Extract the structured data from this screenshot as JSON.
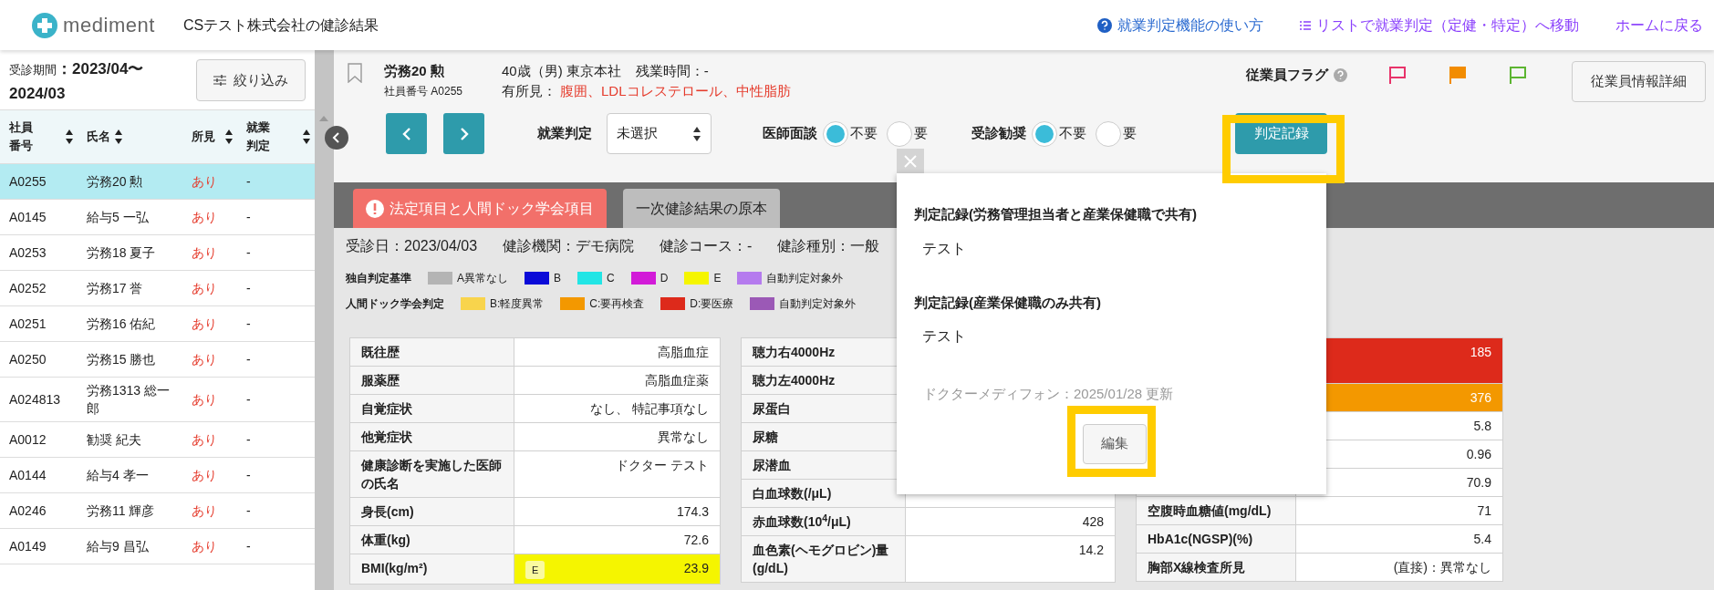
{
  "header": {
    "logo_text": "mediment",
    "company_title": "CSテスト株式会社の健診結果",
    "links": [
      {
        "kind": "help",
        "label": "就業判定機能の使い方"
      },
      {
        "kind": "list",
        "label": "リストで就業判定（定健・特定）へ移動"
      },
      {
        "kind": "plain",
        "label": "ホームに戻る"
      }
    ]
  },
  "sidebar": {
    "period_label": "受診期間",
    "period": "：2023/04〜2024/03",
    "filter_button": "絞り込み",
    "columns": [
      "社員番号",
      "氏名",
      "所見",
      "就業判定"
    ],
    "rows": [
      {
        "id": "A0255",
        "name": "労務20 勲",
        "finding": "あり",
        "judgement": "-",
        "selected": true
      },
      {
        "id": "A0145",
        "name": "給与5 一弘",
        "finding": "あり",
        "judgement": "-",
        "selected": false
      },
      {
        "id": "A0253",
        "name": "労務18 夏子",
        "finding": "あり",
        "judgement": "-",
        "selected": false
      },
      {
        "id": "A0252",
        "name": "労務17 誉",
        "finding": "あり",
        "judgement": "-",
        "selected": false
      },
      {
        "id": "A0251",
        "name": "労務16 佑紀",
        "finding": "あり",
        "judgement": "-",
        "selected": false
      },
      {
        "id": "A0250",
        "name": "労務15 勝也",
        "finding": "あり",
        "judgement": "-",
        "selected": false
      },
      {
        "id": "A024813",
        "name": "労務1313 総一郎",
        "finding": "あり",
        "judgement": "-",
        "selected": false
      },
      {
        "id": "A0012",
        "name": "勧奨 紀夫",
        "finding": "あり",
        "judgement": "-",
        "selected": false
      },
      {
        "id": "A0144",
        "name": "給与4 孝一",
        "finding": "あり",
        "judgement": "-",
        "selected": false
      },
      {
        "id": "A0246",
        "name": "労務11 輝彦",
        "finding": "あり",
        "judgement": "-",
        "selected": false
      },
      {
        "id": "A0149",
        "name": "給与9 昌弘",
        "finding": "あり",
        "judgement": "-",
        "selected": false
      }
    ]
  },
  "employee": {
    "name": "労務20 勲",
    "number": "社員番号 A0255",
    "profile": "40歳（男) 東京本社",
    "overtime": "残業時間：-",
    "findings_label": "有所見：",
    "findings": "腹囲、LDLコレステロール、中性脂肪",
    "flag_label": "従業員フラグ",
    "flags": [
      {
        "color": "#e8336a",
        "filled": false
      },
      {
        "color": "#f28c00",
        "filled": true
      },
      {
        "color": "#5cb531",
        "filled": false
      }
    ],
    "detail_button": "従業員情報詳細"
  },
  "judgement": {
    "label": "就業判定",
    "value": "未選択"
  },
  "radio_groups": [
    {
      "label": "医師面談",
      "options": [
        {
          "label": "不要",
          "selected": true
        },
        {
          "label": "要",
          "selected": false
        }
      ]
    },
    {
      "label": "受診勧奨",
      "options": [
        {
          "label": "不要",
          "selected": true
        },
        {
          "label": "要",
          "selected": false
        }
      ]
    }
  ],
  "record_button": "判定記録",
  "tabs": [
    {
      "label": "法定項目と人間ドック学会項目",
      "selected": true,
      "alert": true
    },
    {
      "label": "一次健診結果の原本",
      "selected": false,
      "alert": false
    }
  ],
  "exam_info": [
    "受診日：2023/04/03",
    "健診機関：デモ病院",
    "健診コース：-",
    "健診種別：一般"
  ],
  "legends": [
    {
      "title": "独自判定基準",
      "items": [
        {
          "label": "A異常なし",
          "color": "#b4b4b4"
        },
        {
          "label": "B",
          "color": "#0a0ad8"
        },
        {
          "label": "C",
          "color": "#22e5e5"
        },
        {
          "label": "D",
          "color": "#d21bd8"
        },
        {
          "label": "E",
          "color": "#f5f500"
        },
        {
          "label": "自動判定対象外",
          "color": "#b57bee"
        }
      ]
    },
    {
      "title": "人間ドック学会判定",
      "items": [
        {
          "label": "B:軽度異常",
          "color": "#f8d44c"
        },
        {
          "label": "C:要再検査",
          "color": "#f39800"
        },
        {
          "label": "D:要医療",
          "color": "#dd2a1b"
        },
        {
          "label": "自動判定対象外",
          "color": "#9b59b6"
        }
      ]
    }
  ],
  "tables": [
    {
      "rows": [
        {
          "label": "既往歴",
          "value": "高脂血症"
        },
        {
          "label": "服薬歴",
          "value": "高脂血症薬"
        },
        {
          "label": "自覚症状",
          "value": "なし、 特記事項なし"
        },
        {
          "label": "他覚症状",
          "value": "異常なし"
        },
        {
          "label": "健康診断を実施した医師の氏名",
          "value": "ドクター テスト"
        },
        {
          "label": "身長(cm)",
          "value": "174.3"
        },
        {
          "label": "体重(kg)",
          "value": "72.6"
        },
        {
          "label": "BMI(kg/m²)",
          "value": "23.9",
          "color": "#f5f500",
          "badge": "E"
        }
      ]
    },
    {
      "rows": [
        {
          "label": "聴力右4000Hz"
        },
        {
          "label": "聴力左4000Hz"
        },
        {
          "label": "尿蛋白"
        },
        {
          "label": "尿糖"
        },
        {
          "label": "尿潜血"
        },
        {
          "label": "白血球数(/μL)"
        },
        {
          "label": "赤血球数(10$^{4}$/μL)",
          "value": "428"
        },
        {
          "label": "血色素(ヘモグロビン)量(g/dL)",
          "value": "14.2"
        }
      ]
    },
    {
      "rows": [
        {
          "value": "185",
          "color": "#dd2a1b"
        },
        {
          "value": "376",
          "color": "#f39800"
        },
        {
          "value": "5.8"
        },
        {
          "value": "0.96"
        },
        {
          "value": "70.9"
        },
        {
          "label": "空腹時血糖値(mg/dL)",
          "value": "71"
        },
        {
          "label": "HbA1c(NGSP)(%)",
          "value": "5.4"
        },
        {
          "label": "胸部X線検査所見",
          "value": "(直接)：異常なし"
        }
      ]
    }
  ],
  "popup": {
    "sections": [
      {
        "heading": "判定記録(労務管理担当者と産業保健職で共有)",
        "text": "テスト"
      },
      {
        "heading": "判定記録(産業保健職のみ共有)",
        "text": "テスト"
      }
    ],
    "updated": "ドクターメディフォン：2025/01/28 更新",
    "edit_button": "編集"
  }
}
